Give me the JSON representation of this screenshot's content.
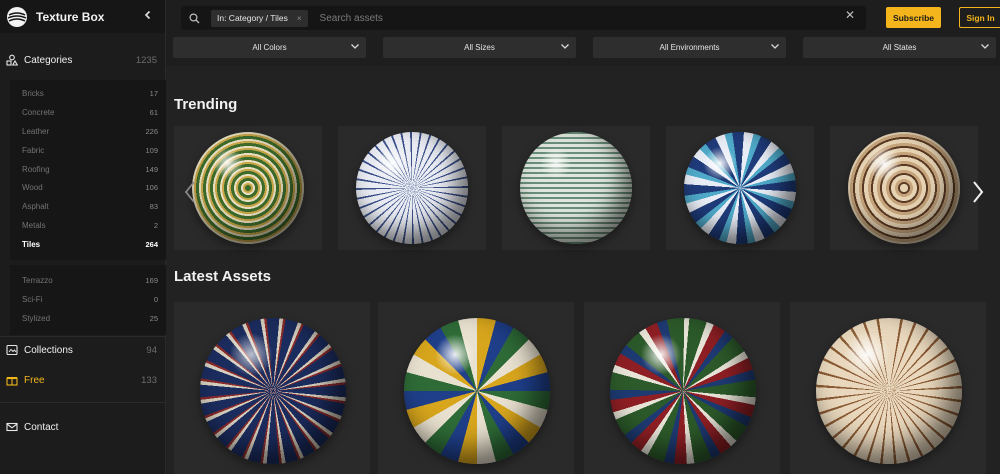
{
  "brand": {
    "name": "Texture Box"
  },
  "sidebar": {
    "categories": {
      "label": "Categories",
      "count": "1235"
    },
    "subitems": [
      {
        "label": "Bricks",
        "count": "17"
      },
      {
        "label": "Concrete",
        "count": "61"
      },
      {
        "label": "Leather",
        "count": "226"
      },
      {
        "label": "Fabric",
        "count": "109"
      },
      {
        "label": "Roofing",
        "count": "149"
      },
      {
        "label": "Wood",
        "count": "106"
      },
      {
        "label": "Asphalt",
        "count": "83"
      },
      {
        "label": "Metals",
        "count": "2"
      },
      {
        "label": "Tiles",
        "count": "264"
      },
      {
        "label": "Terrazzo",
        "count": "169"
      },
      {
        "label": "Sci-Fi",
        "count": "0"
      },
      {
        "label": "Stylized",
        "count": "25"
      }
    ],
    "collections": {
      "label": "Collections",
      "count": "94"
    },
    "free": {
      "label": "Free",
      "count": "133"
    },
    "contact": {
      "label": "Contact"
    }
  },
  "search": {
    "chip": "In: Category / Tiles",
    "chip_close": "×",
    "placeholder": "Search assets",
    "clear": "✕"
  },
  "buttons": {
    "subscribe": "Subscribe",
    "signin": "Sign In"
  },
  "filters": [
    "All Colors",
    "All Sizes",
    "All Environments",
    "All States"
  ],
  "sections": {
    "trending": "Trending",
    "latest": "Latest Assets"
  },
  "colors": {
    "accent": "#f3b51b"
  },
  "icons": {
    "categories": "shapes-icon",
    "collections": "collections-icon",
    "free": "gift-icon",
    "contact": "mail-icon",
    "search": "search-icon",
    "collapse": "chevron-left-icon",
    "prev": "chevron-left-icon",
    "next": "chevron-right-icon"
  },
  "trending": [
    {
      "pattern": "green-gold-star"
    },
    {
      "pattern": "blue-white-lattice"
    },
    {
      "pattern": "mint-small-grid"
    },
    {
      "pattern": "navy-white-star"
    },
    {
      "pattern": "brown-cream-rosette"
    }
  ],
  "latest": [
    {
      "pattern": "navy-star-lattice"
    },
    {
      "pattern": "multicolor-star"
    },
    {
      "pattern": "green-red-star"
    },
    {
      "pattern": "beige-brown-lattice"
    }
  ]
}
